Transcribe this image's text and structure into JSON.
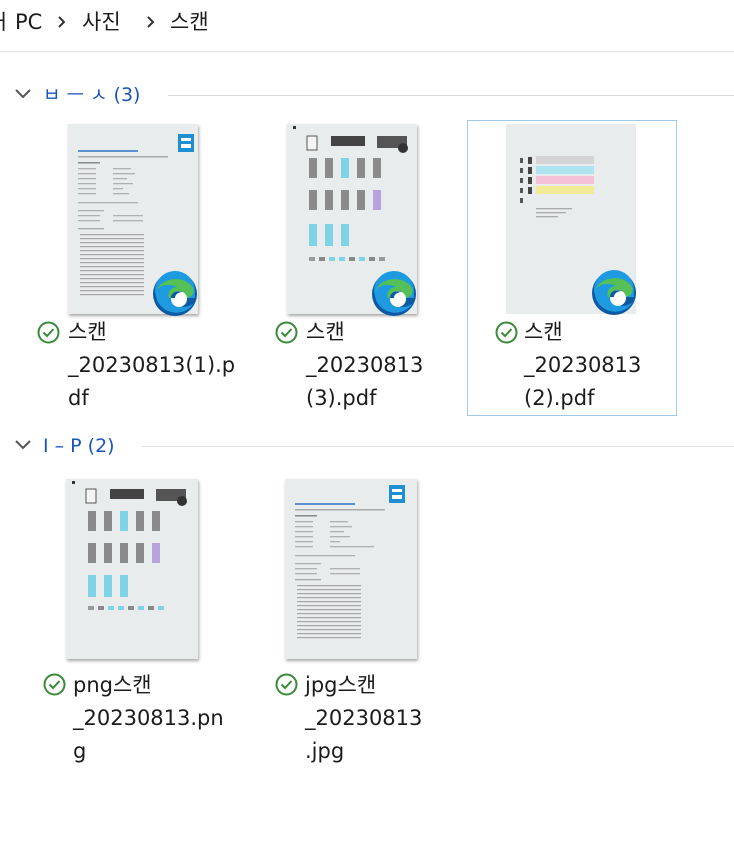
{
  "breadcrumb": [
    "PC",
    "사진",
    "스캔"
  ],
  "groups": [
    {
      "label": "ㅂ ㅡ ㅅ (3)",
      "items": [
        {
          "name_lines": [
            "스캔",
            "_20230813(1).p",
            "df"
          ]
        },
        {
          "name_lines": [
            "스캔",
            "_20230813",
            "(3).pdf"
          ]
        },
        {
          "name_lines": [
            "스캔",
            "_20230813",
            "(2).pdf"
          ]
        }
      ]
    },
    {
      "label": "I – P (2)",
      "items": [
        {
          "name_lines": [
            "png스캔",
            "_20230813.pn",
            "g"
          ]
        },
        {
          "name_lines": [
            "jpg스캔",
            "_20230813",
            ".jpg"
          ]
        }
      ]
    }
  ],
  "colors": {
    "group_label": "#1a55b8",
    "status_ok": "#3a8a3a",
    "selection_border": "#9fcbe8",
    "edge_blue": "#0c59a4",
    "edge_green": "#54c056"
  },
  "icons": {
    "sync_status": "check-circle-icon",
    "pdf_app": "edge-icon",
    "expand": "chevron-down-icon",
    "separator": "chevron-right-icon"
  }
}
